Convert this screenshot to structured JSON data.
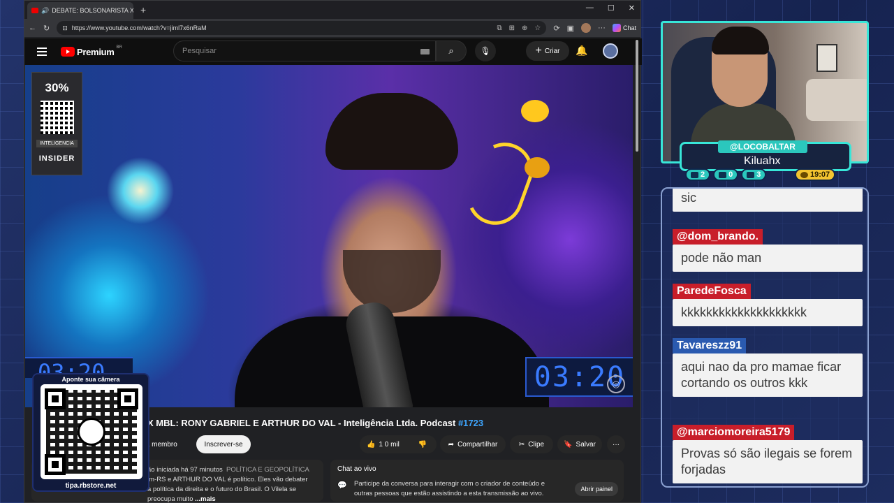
{
  "browser": {
    "tab_title": "DEBATE: BOLSONARISTA X M",
    "url": "https://www.youtube.com/watch?v=jiml7x6nRaM",
    "chat_label": "Chat"
  },
  "youtube": {
    "logo": "Premium",
    "region": "BR",
    "search_placeholder": "Pesquisar",
    "create_label": "Criar"
  },
  "video": {
    "promo_discount": "30%",
    "promo_label": "INTELIGENCIA",
    "promo_brand": "INSIDER",
    "timer_big": "03:20",
    "timer_small": "03:20",
    "title": "X MBL: RONY GABRIEL E ARTHUR DO VAL - Inteligência Ltda. Podcast ",
    "title_tag": "#1723"
  },
  "actions": {
    "member": "eja membro",
    "subscribe": "Inscrever-se",
    "likes": "1 0 mil",
    "share": "Compartilhar",
    "clip": "Clipe",
    "save": "Salvar"
  },
  "description": {
    "line1": "ão iniciada há 97 minutos",
    "category": "POLÍTICA E GEOPOLÍTICA",
    "line2": "im-RS e ARTHUR DO VAL é político. Eles vão debater",
    "line3": "a política da direita e o futuro do Brasil. O Vilela se preocupa muito",
    "more": "...mais"
  },
  "livechat": {
    "title": "Chat ao vivo",
    "text": "Participe da conversa para interagir com o criador de conteúdo e outras pessoas que estão assistindo a esta transmissão ao vivo.",
    "button": "Abrir painel"
  },
  "qr_overlay": {
    "top": "Aponte sua câmera",
    "bottom": "tipa.rbstore.net"
  },
  "stream": {
    "handle": "@LOCOBALTAR",
    "name": "Kiluahx",
    "stats": {
      "twitch": "2",
      "youtube": "0",
      "kick": "3",
      "time": "19:07"
    }
  },
  "chat": [
    {
      "user": "",
      "text": "sic"
    },
    {
      "user": "@dom_brando.",
      "text": "pode não man",
      "color": "red"
    },
    {
      "user": "ParedeFosca",
      "text": "kkkkkkkkkkkkkkkkkkkk",
      "color": "red"
    },
    {
      "user": "Tavareszz91",
      "text": "aqui nao da pro mamae ficar cortando os outros kkk",
      "color": "blue"
    },
    {
      "user": "@marciomoreira5179",
      "text": "Provas só são ilegais se forem forjadas",
      "color": "red"
    }
  ]
}
